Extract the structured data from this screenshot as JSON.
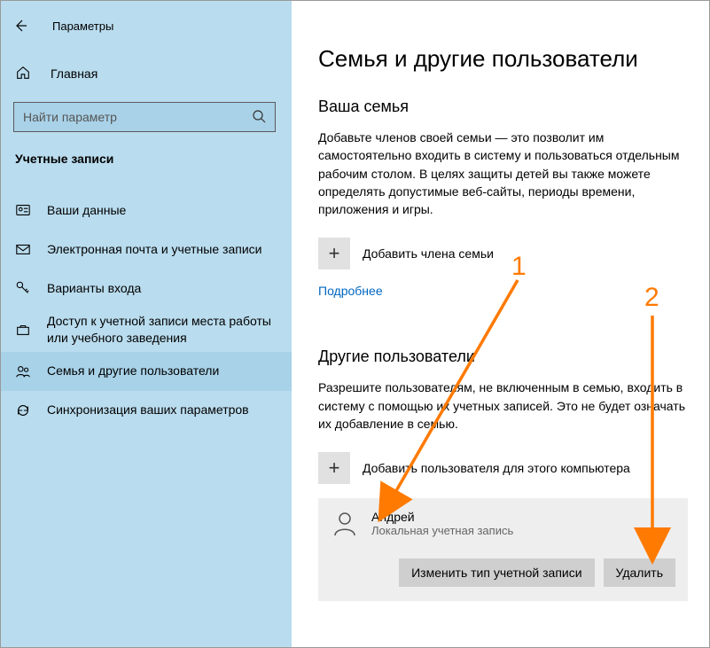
{
  "app": {
    "title": "Параметры"
  },
  "sidebar": {
    "home": "Главная",
    "search_placeholder": "Найти параметр",
    "category": "Учетные записи",
    "items": [
      {
        "label": "Ваши данные"
      },
      {
        "label": "Электронная почта и учетные записи"
      },
      {
        "label": "Варианты входа"
      },
      {
        "label": "Доступ к учетной записи места работы или учебного заведения"
      },
      {
        "label": "Семья и другие пользователи"
      },
      {
        "label": "Синхронизация ваших параметров"
      }
    ]
  },
  "main": {
    "heading": "Семья и другие пользователи",
    "family": {
      "title": "Ваша семья",
      "desc": "Добавьте членов своей семьи — это позволит им самостоятельно входить в систему и пользоваться отдельным рабочим столом. В целях защиты детей вы также можете определять допустимые веб-сайты, периоды времени, приложения и игры.",
      "add": "Добавить члена семьи",
      "more": "Подробнее"
    },
    "others": {
      "title": "Другие пользователи",
      "desc": "Разрешите пользователям, не включенным в семью, входить в систему с помощью их учетных записей. Это не будет означать их добавление в семью.",
      "add": "Добавить пользователя для этого компьютера"
    },
    "user": {
      "name": "Андрей",
      "type": "Локальная учетная запись",
      "change_type": "Изменить тип учетной записи",
      "delete": "Удалить"
    }
  },
  "annotations": {
    "n1": "1",
    "n2": "2"
  }
}
